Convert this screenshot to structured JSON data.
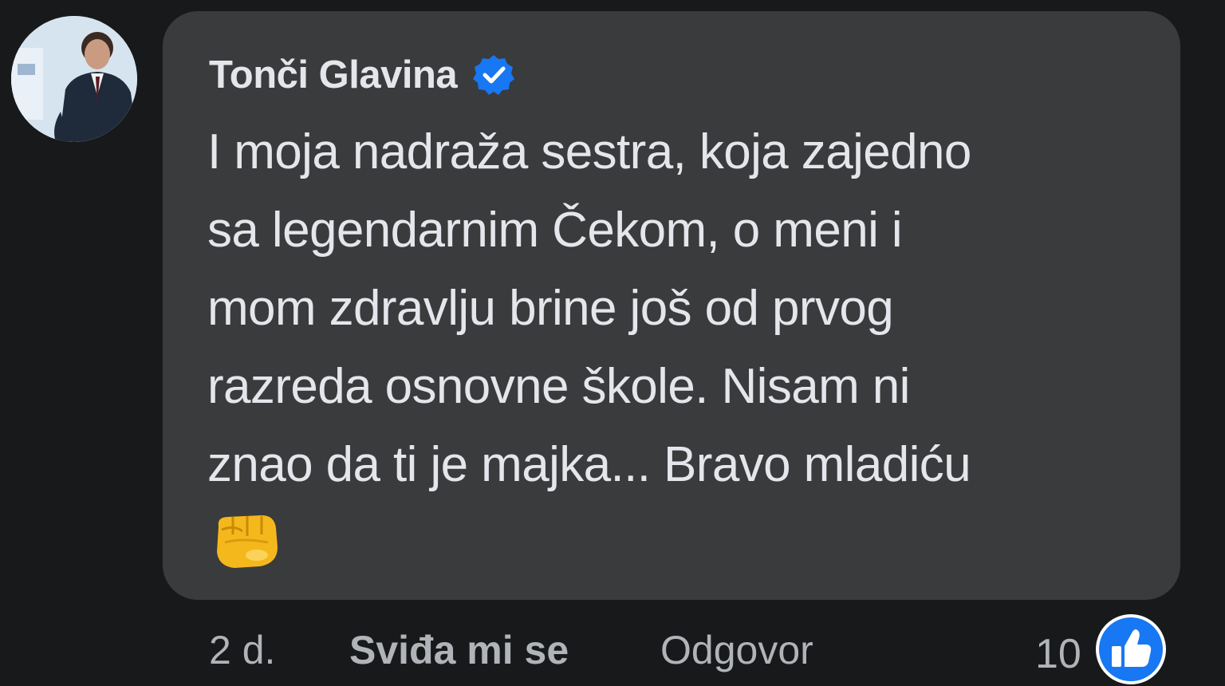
{
  "comment": {
    "author": "Tonči Glavina",
    "verified": true,
    "lines": [
      "I moja nadraža sestra, koja zajedno",
      "sa legendarnim Čekom, o meni i",
      "mom zdravlju brine još od prvog",
      "razreda osnovne škole. Nisam ni",
      "znao da ti je majka... Bravo mladiću"
    ],
    "emoji": "oncoming-fist-icon"
  },
  "actions": {
    "time": "2 d.",
    "like_label": "Sviđa mi se",
    "reply_label": "Odgovor"
  },
  "reactions": {
    "count": "10",
    "icon": "like-thumb-icon"
  },
  "colors": {
    "background": "#18191a",
    "bubble": "#3a3b3c",
    "text": "#e4e6eb",
    "secondary_text": "#b0b3b8",
    "verified_blue": "#1877f2"
  }
}
